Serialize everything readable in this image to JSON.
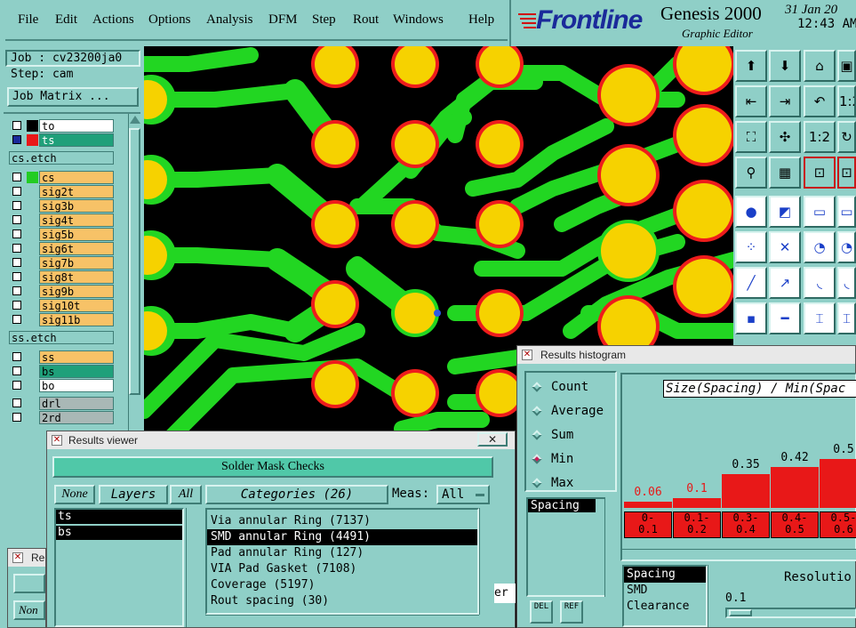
{
  "menu": {
    "file": "File",
    "edit": "Edit",
    "actions": "Actions",
    "options": "Options",
    "analysis": "Analysis",
    "dfm": "DFM",
    "step": "Step",
    "rout": "Rout",
    "windows": "Windows",
    "help": "Help"
  },
  "brand": {
    "logo": "Frontline",
    "product": "Genesis 2000",
    "subtitle": "Graphic Editor",
    "date": "31 Jan 20",
    "time": "12:43 AM"
  },
  "job": {
    "job_label": "Job : cv23200ja0",
    "step_label": "Step: cam",
    "matrix_button": "Job Matrix ..."
  },
  "layers": [
    {
      "name": "to",
      "color": "#000000",
      "bg": "#ffffff"
    },
    {
      "name": "ts",
      "color": "#e81818",
      "bg": "#1fa07a",
      "selected": true
    },
    {
      "name": "cs.etch",
      "color": "",
      "bg": "#8fcfc7",
      "header": true
    },
    {
      "name": "cs",
      "color": "#22cc22",
      "bg": "#f7c267"
    },
    {
      "name": "sig2t",
      "color": "",
      "bg": "#f7c267"
    },
    {
      "name": "sig3b",
      "color": "",
      "bg": "#f7c267"
    },
    {
      "name": "sig4t",
      "color": "",
      "bg": "#f7c267"
    },
    {
      "name": "sig5b",
      "color": "",
      "bg": "#f7c267"
    },
    {
      "name": "sig6t",
      "color": "",
      "bg": "#f7c267"
    },
    {
      "name": "sig7b",
      "color": "",
      "bg": "#f7c267"
    },
    {
      "name": "sig8t",
      "color": "",
      "bg": "#f7c267"
    },
    {
      "name": "sig9b",
      "color": "",
      "bg": "#f7c267"
    },
    {
      "name": "sig10t",
      "color": "",
      "bg": "#f7c267"
    },
    {
      "name": "sig11b",
      "color": "",
      "bg": "#f7c267"
    },
    {
      "name": "ss.etch",
      "color": "",
      "bg": "#8fcfc7",
      "header": true
    },
    {
      "name": "ss",
      "color": "",
      "bg": "#f7c267"
    },
    {
      "name": "bs",
      "color": "",
      "bg": "#1fa07a"
    },
    {
      "name": "bo",
      "color": "",
      "bg": "#ffffff"
    },
    {
      "name": "drl",
      "color": "",
      "bg": "#a9b8b6"
    },
    {
      "name": "2rd",
      "color": "",
      "bg": "#a9b8b6"
    }
  ],
  "results_viewer": {
    "title": "Results viewer",
    "header": "Solder Mask Checks",
    "none_btn": "None",
    "layers_btn": "Layers",
    "all_btn": "All",
    "layer_list": [
      "ts",
      "bs"
    ],
    "categories_btn": "Categories (26)",
    "meas_label": "Meas:",
    "meas_value": "All",
    "categories": [
      "Via annular Ring (7137)",
      "SMD annular Ring (4491)",
      "Pad annular Ring (127)",
      "VIA Pad Gasket (7108)",
      "Coverage (5197)",
      "Rout spacing (30)"
    ],
    "selected_category": 1,
    "partial_label": "er"
  },
  "small_window": {
    "title": "Re",
    "field": "Non"
  },
  "histogram": {
    "title": "Results histogram",
    "options": [
      "Count",
      "Average",
      "Sum",
      "Min",
      "Max"
    ],
    "selected_option": "Min",
    "measure_list": [
      "Spacing"
    ],
    "chart_title": "Size(Spacing) / Min(Spac",
    "buttons": {
      "del": "DEL",
      "ref": "REF"
    },
    "metric_list": [
      "Spacing",
      "SMD",
      "Clearance"
    ],
    "resolution_label": "Resolutio",
    "resolution_value": "0.1",
    "colors": {
      "bar": "#e81818"
    }
  },
  "chart_data": {
    "type": "bar",
    "title": "Size(Spacing) / Min(Spac",
    "categories": [
      "0-\n0.1",
      "0.1-\n0.2",
      "0.3-\n0.4",
      "0.4-\n0.5",
      "0.5-\n0.6"
    ],
    "category_lines": [
      [
        "0-",
        "0.1"
      ],
      [
        "0.1-",
        "0.2"
      ],
      [
        "0.3-",
        "0.4"
      ],
      [
        "0.4-",
        "0.5"
      ],
      [
        "0.5-",
        "0.6"
      ]
    ],
    "values": [
      0.06,
      0.1,
      0.35,
      0.42,
      0.5
    ],
    "value_labels": [
      "0.06",
      "0.1",
      "0.35",
      "0.42",
      "0.5"
    ]
  },
  "pcb_colors": {
    "trace": "#22d622",
    "pad": "#f6d200",
    "mask": "#ee1c1c",
    "board": "#000000"
  }
}
